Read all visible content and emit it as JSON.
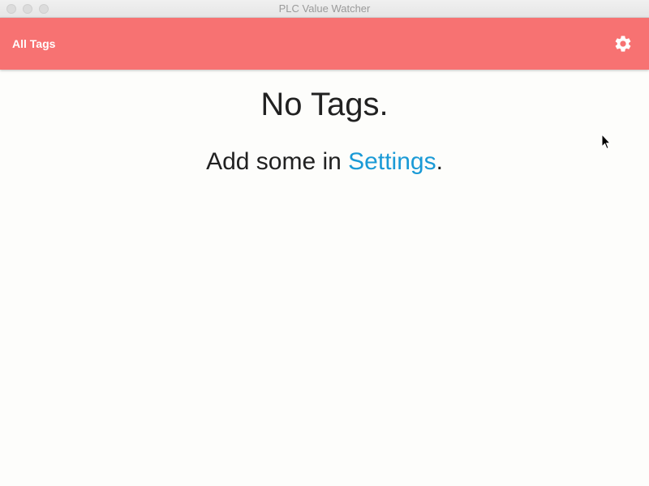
{
  "window": {
    "title": "PLC Value Watcher"
  },
  "appbar": {
    "title": "All Tags",
    "settings_icon": "gear-icon",
    "color": "#f77272"
  },
  "empty_state": {
    "headline": "No Tags.",
    "prefix": "Add some in ",
    "link_label": "Settings",
    "suffix": ".",
    "link_color": "#1a9ad6"
  }
}
